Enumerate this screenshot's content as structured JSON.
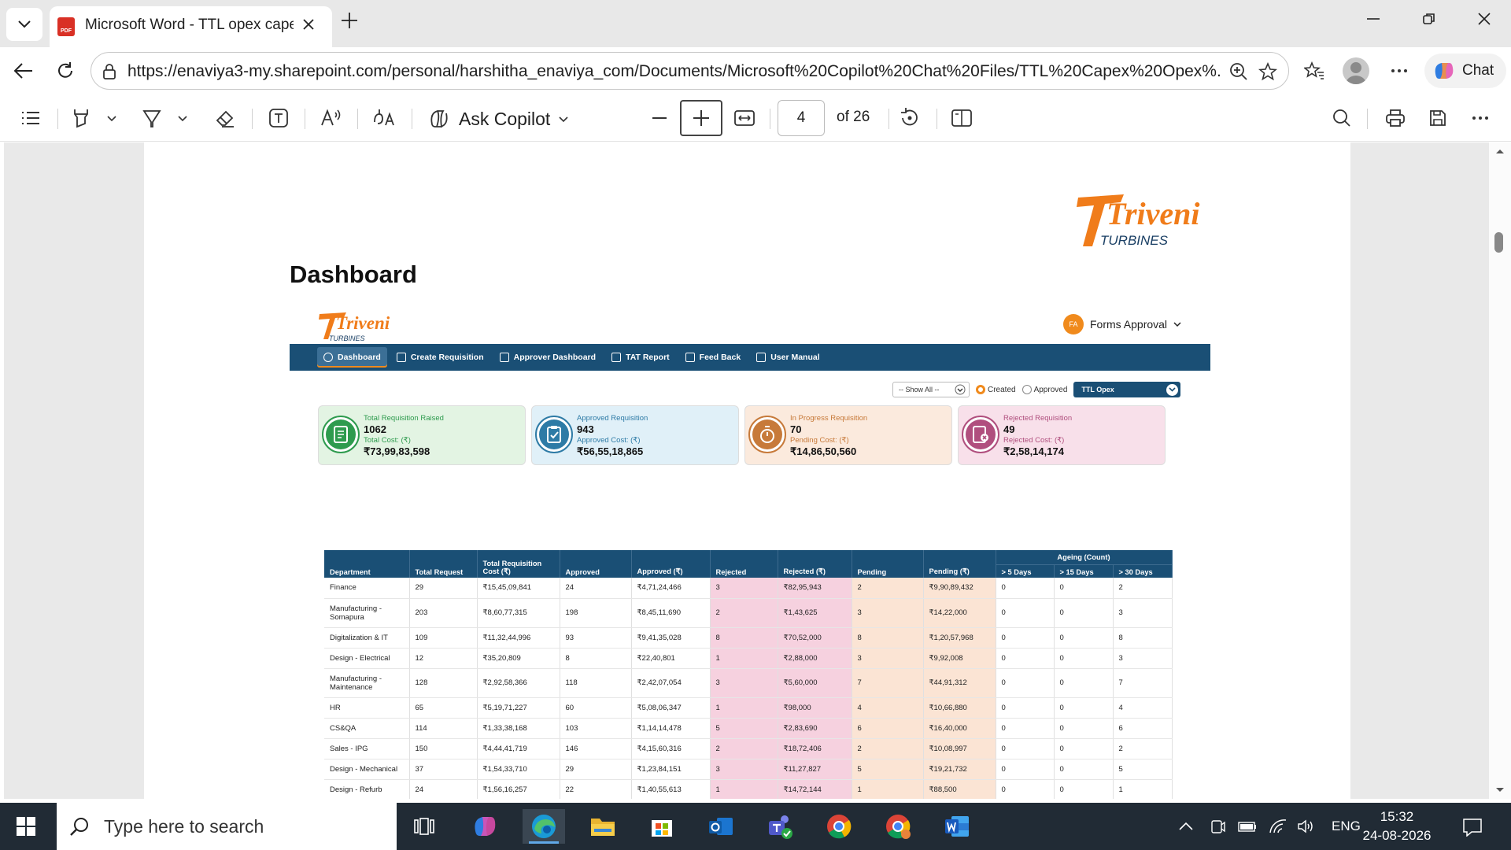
{
  "browser": {
    "tab_title": "Microsoft Word - TTL opex capex",
    "tab_icon_text": "PDF",
    "url": "https://enaviya3-my.sharepoint.com/personal/harshitha_enaviya_com/Documents/Microsoft%20Copilot%20Chat%20Files/TTL%20Capex%20Opex%...",
    "chat_label": "Chat"
  },
  "pdf_toolbar": {
    "ask_copilot": "Ask Copilot",
    "current_page": "4",
    "page_count": "of 26"
  },
  "document": {
    "logo_text": "Triveni",
    "logo_subtext": "TURBINES",
    "title": "Dashboard"
  },
  "app": {
    "logo_text": "Triveni",
    "logo_subtext": "TURBINES",
    "user_initials": "FA",
    "user_menu": "Forms Approval",
    "nav": [
      "Dashboard",
      "Create Requisition",
      "Approver Dashboard",
      "TAT Report",
      "Feed Back",
      "User Manual"
    ],
    "filter_show": "-- Show All --",
    "radio_created": "Created",
    "radio_approved": "Approved",
    "type_select": "TTL Opex",
    "cards": [
      {
        "title": "Total Requisition Raised",
        "count": "1062",
        "cost_label": "Total Cost: (₹)",
        "cost": "₹73,99,83,598",
        "color": "#2e9b4e",
        "bg": "#e3f4e3"
      },
      {
        "title": "Approved Requisition",
        "count": "943",
        "cost_label": "Approved Cost: (₹)",
        "cost": "₹56,55,18,865",
        "color": "#2e7ba6",
        "bg": "#e0f0f8"
      },
      {
        "title": "In Progress Requisition",
        "count": "70",
        "cost_label": "Pending Cost: (₹)",
        "cost": "₹14,86,50,560",
        "color": "#c77a3a",
        "bg": "#fbeadd"
      },
      {
        "title": "Rejected Requisition",
        "count": "49",
        "cost_label": "Rejected Cost: (₹)",
        "cost": "₹2,58,14,174",
        "color": "#b04f7e",
        "bg": "#f8e0ea"
      }
    ],
    "table": {
      "ageing_header": "Ageing (Count)",
      "headers": [
        "Department",
        "Total Request",
        "Total Requisition Cost (₹)",
        "Approved",
        "Approved (₹)",
        "Rejected",
        "Rejected (₹)",
        "Pending",
        "Pending (₹)",
        "> 5 Days",
        "> 15 Days",
        "> 30 Days"
      ],
      "rows": [
        [
          "Finance",
          "29",
          "₹15,45,09,841",
          "24",
          "₹4,71,24,466",
          "3",
          "₹82,95,943",
          "2",
          "₹9,90,89,432",
          "0",
          "0",
          "2"
        ],
        [
          "Manufacturing - Somapura",
          "203",
          "₹8,60,77,315",
          "198",
          "₹8,45,11,690",
          "2",
          "₹1,43,625",
          "3",
          "₹14,22,000",
          "0",
          "0",
          "3"
        ],
        [
          "Digitalization & IT",
          "109",
          "₹11,32,44,996",
          "93",
          "₹9,41,35,028",
          "8",
          "₹70,52,000",
          "8",
          "₹1,20,57,968",
          "0",
          "0",
          "8"
        ],
        [
          "Design - Electrical",
          "12",
          "₹35,20,809",
          "8",
          "₹22,40,801",
          "1",
          "₹2,88,000",
          "3",
          "₹9,92,008",
          "0",
          "0",
          "3"
        ],
        [
          "Manufacturing - Maintenance",
          "128",
          "₹2,92,58,366",
          "118",
          "₹2,42,07,054",
          "3",
          "₹5,60,000",
          "7",
          "₹44,91,312",
          "0",
          "0",
          "7"
        ],
        [
          "HR",
          "65",
          "₹5,19,71,227",
          "60",
          "₹5,08,06,347",
          "1",
          "₹98,000",
          "4",
          "₹10,66,880",
          "0",
          "0",
          "4"
        ],
        [
          "CS&QA",
          "114",
          "₹1,33,38,168",
          "103",
          "₹1,14,14,478",
          "5",
          "₹2,83,690",
          "6",
          "₹16,40,000",
          "0",
          "0",
          "6"
        ],
        [
          "Sales - IPG",
          "150",
          "₹4,44,41,719",
          "146",
          "₹4,15,60,316",
          "2",
          "₹18,72,406",
          "2",
          "₹10,08,997",
          "0",
          "0",
          "2"
        ],
        [
          "Design - Mechanical",
          "37",
          "₹1,54,33,710",
          "29",
          "₹1,23,84,151",
          "3",
          "₹11,27,827",
          "5",
          "₹19,21,732",
          "0",
          "0",
          "5"
        ],
        [
          "Design - Refurb",
          "24",
          "₹1,56,16,257",
          "22",
          "₹1,40,55,613",
          "1",
          "₹14,72,144",
          "1",
          "₹88,500",
          "0",
          "0",
          "1"
        ]
      ]
    }
  },
  "taskbar": {
    "search_placeholder": "Type here to search",
    "language": "ENG",
    "time": "15:32",
    "date": "24-08-2026"
  }
}
